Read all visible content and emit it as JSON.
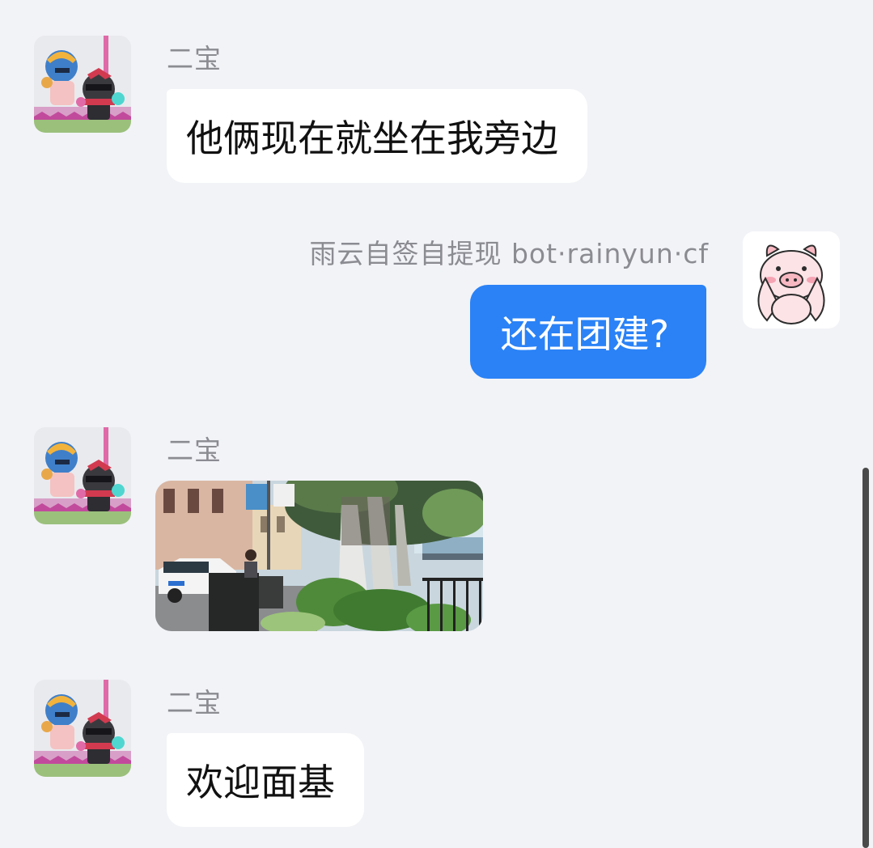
{
  "messages": [
    {
      "sender": "二宝",
      "type": "text",
      "text": "他俩现在就坐在我旁边",
      "direction": "in"
    },
    {
      "sender": "雨云自签自提现 bot·rainyun·cf",
      "type": "text",
      "text": "还在团建?",
      "direction": "out"
    },
    {
      "sender": "二宝",
      "type": "image",
      "description": "street-photo",
      "direction": "in"
    },
    {
      "sender": "二宝",
      "type": "text",
      "text": "欢迎面基",
      "direction": "in"
    }
  ],
  "colors": {
    "background": "#f2f3f7",
    "incoming_bubble": "#ffffff",
    "outgoing_bubble": "#2a82f6",
    "name_text": "#8b8b92"
  },
  "icons": {
    "incoming_avatar": "knight-game-characters-avatar",
    "outgoing_avatar": "pink-pig-avatar"
  }
}
